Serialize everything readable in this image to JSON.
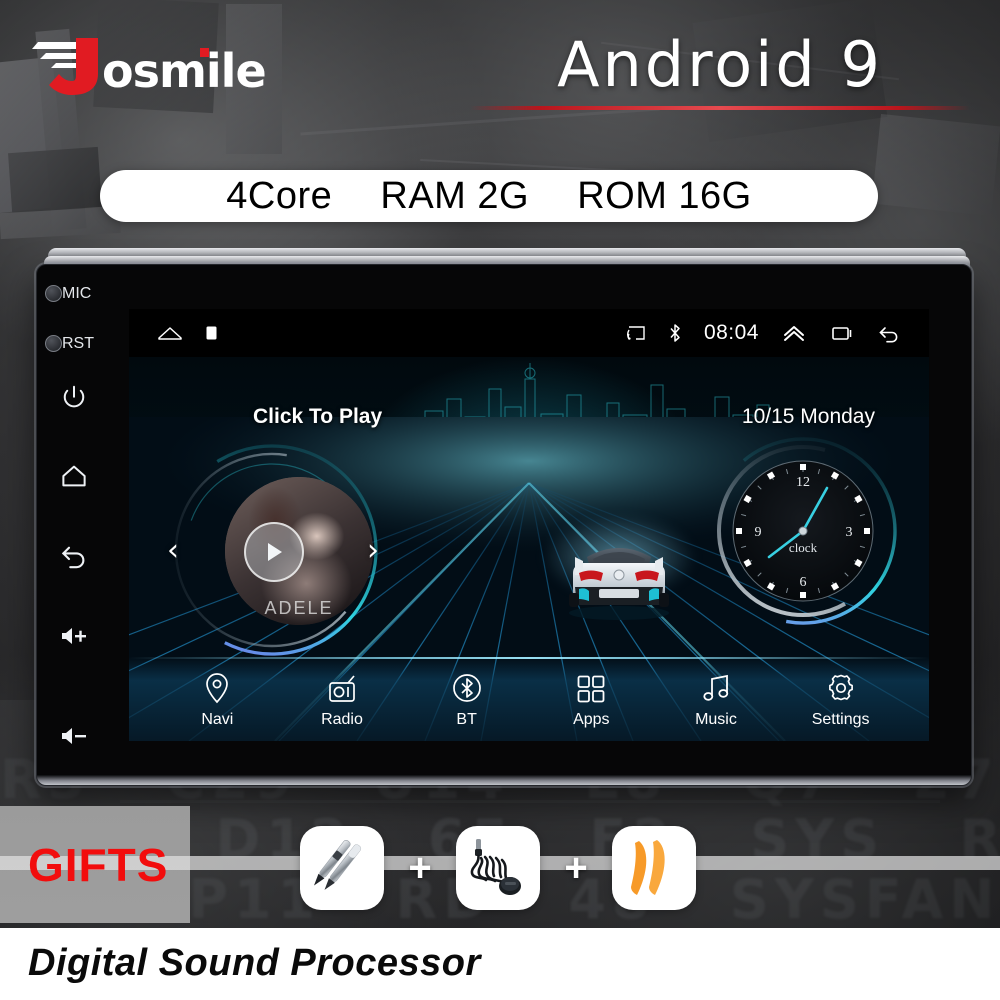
{
  "brand": {
    "logo_text": "Josmile",
    "logo_icon": "josmile-wing-logo",
    "red": "#e11b22",
    "white": "#ffffff"
  },
  "header": {
    "android_title": "Android 9",
    "rule_color": "#b9151c",
    "spec_pill": {
      "core": "4Core",
      "ram": "RAM 2G",
      "rom": "ROM 16G"
    }
  },
  "device": {
    "bezel_buttons": [
      {
        "name": "MIC",
        "label": "MIC",
        "type": "hole"
      },
      {
        "name": "RST",
        "label": "RST",
        "type": "hole"
      },
      {
        "name": "power",
        "label": "",
        "type": "icon",
        "icon": "power-icon"
      },
      {
        "name": "home",
        "label": "",
        "type": "icon",
        "icon": "home-icon"
      },
      {
        "name": "back",
        "label": "",
        "type": "icon",
        "icon": "back-icon"
      },
      {
        "name": "volume-up",
        "label": "",
        "type": "icon",
        "icon": "volume-up-icon"
      },
      {
        "name": "volume-down",
        "label": "",
        "type": "icon",
        "icon": "volume-down-icon"
      }
    ]
  },
  "screen": {
    "statusbar": {
      "left_icons": [
        "home-icon",
        "stop-square-icon"
      ],
      "right_icons": [
        "cast-signal-icon",
        "bluetooth-icon"
      ],
      "time": "08:04",
      "trailing_icons": [
        "chevron-up-icon",
        "recents-icon",
        "back-icon"
      ]
    },
    "music_widget": {
      "title": "Click To Play",
      "album_artist": "ADELE",
      "play_icon": "play-icon",
      "prev_icon": "chevron-left-icon",
      "next_icon": "chevron-right-icon"
    },
    "clock_widget": {
      "date": "10/15 Monday",
      "face_label": "clock",
      "numerals": [
        "12",
        "3",
        "6",
        "9"
      ]
    },
    "wallpaper": {
      "description": "car-on-grid-road",
      "car": "bmw-i8-rear",
      "accent": "#1fc8d8"
    },
    "dock": [
      {
        "label": "Navi",
        "icon": "map-pin-icon"
      },
      {
        "label": "Radio",
        "icon": "radio-icon"
      },
      {
        "label": "BT",
        "icon": "bluetooth-icon"
      },
      {
        "label": "Apps",
        "icon": "apps-grid-icon"
      },
      {
        "label": "Music",
        "icon": "music-note-icon"
      },
      {
        "label": "Settings",
        "icon": "gear-icon"
      }
    ]
  },
  "gifts": {
    "label": "GIFTS",
    "label_color": "#f20d0d",
    "separator": "+",
    "items": [
      {
        "name": "stylus-pen",
        "icon": "stylus-pen-icon"
      },
      {
        "name": "external-microphone",
        "icon": "microphone-cable-icon"
      },
      {
        "name": "pry-trim-tools",
        "icon": "pry-tool-icon"
      }
    ]
  },
  "footer": {
    "banner_text": "Digital Sound Processor"
  }
}
